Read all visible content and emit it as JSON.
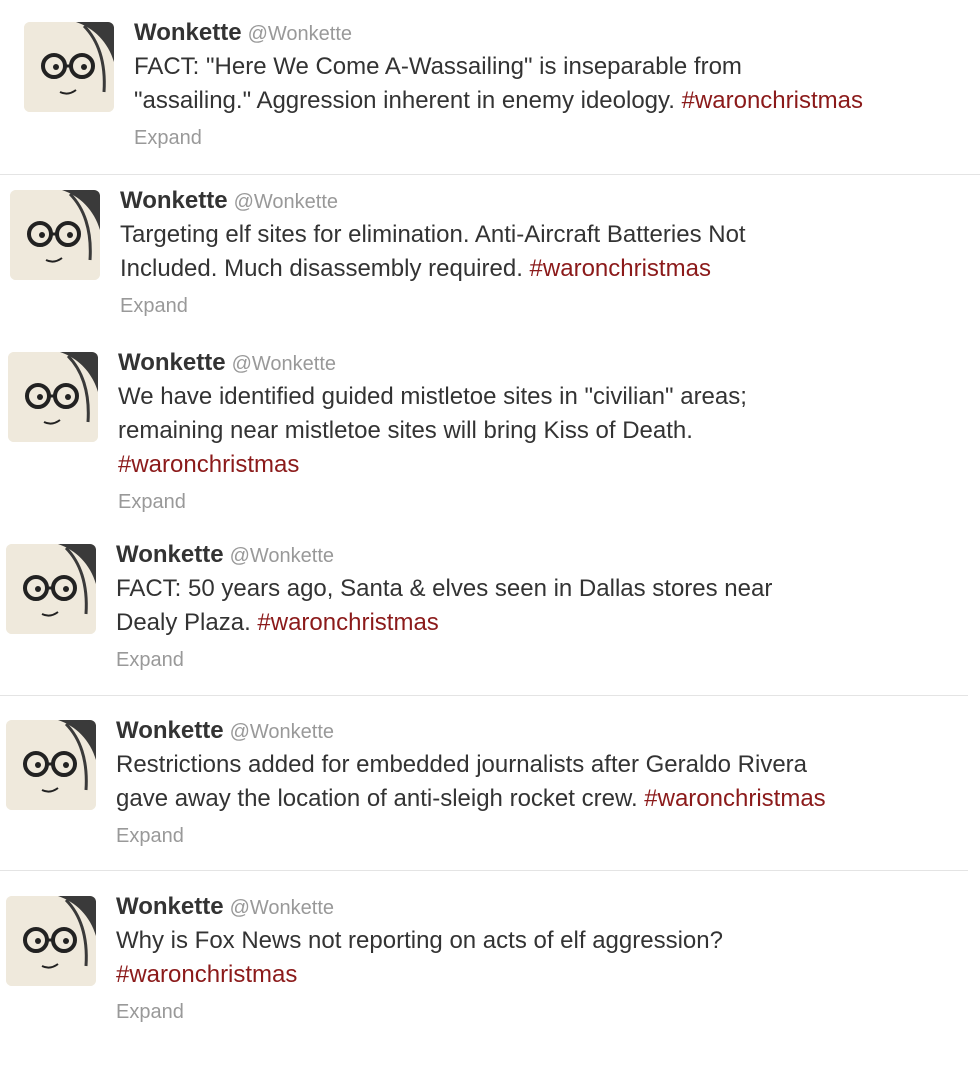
{
  "tweets": [
    {
      "name": "Wonkette",
      "handle": "@Wonkette",
      "lines": [
        "FACT: \"Here We Come A-Wassailing\" is inseparable from",
        "\"assailing.\" Aggression inherent in enemy ideology. "
      ],
      "hashtag": "#waronchristmas",
      "expand": "Expand"
    },
    {
      "name": "Wonkette",
      "handle": "@Wonkette",
      "lines": [
        "Targeting elf sites for elimination. Anti-Aircraft Batteries Not",
        "Included. Much disassembly required. "
      ],
      "hashtag": "#waronchristmas",
      "expand": "Expand"
    },
    {
      "name": "Wonkette",
      "handle": "@Wonkette",
      "lines": [
        "We have identified guided mistletoe sites in \"civilian\" areas;",
        "remaining near mistletoe sites will bring Kiss of Death.",
        ""
      ],
      "hashtag": "#waronchristmas",
      "expand": "Expand"
    },
    {
      "name": "Wonkette",
      "handle": "@Wonkette",
      "lines": [
        "FACT: 50 years ago, Santa & elves seen in Dallas stores near",
        "Dealy Plaza. "
      ],
      "hashtag": "#waronchristmas",
      "expand": "Expand"
    },
    {
      "name": "Wonkette",
      "handle": "@Wonkette",
      "lines": [
        "Restrictions added for embedded journalists after Geraldo Rivera",
        "gave away the location of anti-sleigh rocket crew. "
      ],
      "hashtag": "#waronchristmas",
      "expand": "Expand"
    },
    {
      "name": "Wonkette",
      "handle": "@Wonkette",
      "lines": [
        "Why is Fox News not reporting on acts of elf aggression?",
        ""
      ],
      "hashtag": "#waronchristmas",
      "expand": "Expand"
    }
  ],
  "colors": {
    "hashtag": "#8b1a1a",
    "muted": "#999999",
    "text": "#333333",
    "avatar_bg": "#efe9dc"
  },
  "avatar_icon": "cartoon-woman-glasses-avatar"
}
